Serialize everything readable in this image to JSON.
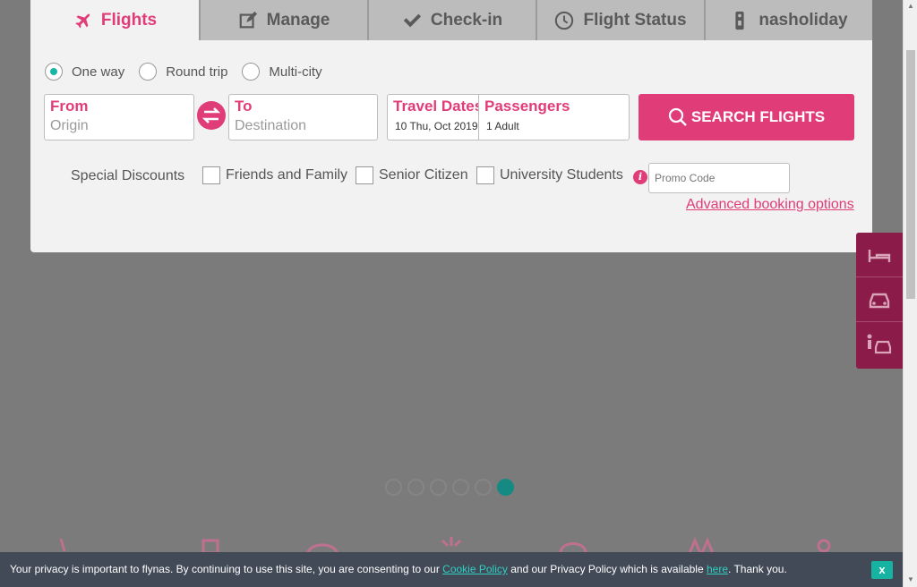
{
  "tabs": [
    {
      "label": "Flights",
      "icon": "airplane-icon"
    },
    {
      "label": "Manage",
      "icon": "edit-icon"
    },
    {
      "label": "Check-in",
      "icon": "checkmark-icon"
    },
    {
      "label": "Flight Status",
      "icon": "clock-icon"
    },
    {
      "label": "nasholiday",
      "icon": "door-hanger-icon"
    }
  ],
  "trip_types": [
    "One way",
    "Round trip",
    "Multi-city"
  ],
  "selected_trip_type": "One way",
  "from": {
    "label": "From",
    "placeholder": "Origin"
  },
  "to": {
    "label": "To",
    "placeholder": "Destination"
  },
  "dates": {
    "label": "Travel Dates",
    "value": "10 Thu, Oct 2019"
  },
  "passengers": {
    "label": "Passengers",
    "value": "1 Adult"
  },
  "search_label": "SEARCH FLIGHTS",
  "discounts": {
    "label": "Special Discounts",
    "options": [
      "Friends and Family",
      "Senior Citizen",
      "University Students"
    ],
    "promo_placeholder": "Promo Code"
  },
  "advanced_label": "Advanced booking options",
  "side_menu": [
    "hotel-icon",
    "car-icon",
    "transfer-icon"
  ],
  "carousel": {
    "count": 6,
    "active": 6
  },
  "cookie": {
    "text_before": "Your privacy is important to flynas. By continuing to use this site, you are consenting to our ",
    "cookie_link": "Cookie Policy",
    "text_middle": " and our Privacy Policy which is available ",
    "here_link": "here",
    "text_after": ". Thank you.",
    "close_label": "x"
  },
  "colors": {
    "accent": "#e03c78",
    "teal": "#18b6a6",
    "side": "#8b1b48",
    "cookie_bg": "#424a57"
  }
}
